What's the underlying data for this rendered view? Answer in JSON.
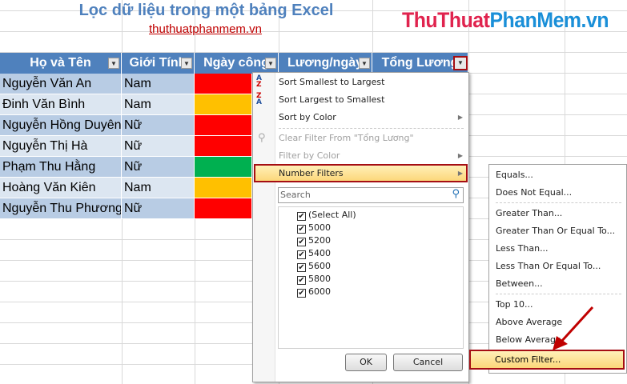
{
  "title": "Lọc dữ liệu trong một bảng Excel",
  "link": "thuthuatphanmem.vn",
  "logo": {
    "part1": "ThuThuat",
    "part2": "PhanMem.vn"
  },
  "headers": [
    "Họ và Tên",
    "Giới Tính",
    "Ngày công",
    "Lương/ngày",
    "Tổng Lương"
  ],
  "rows": [
    {
      "name": "Nguyễn Văn An",
      "gender": "Nam",
      "color": "#ff0000"
    },
    {
      "name": "Đinh Văn Bình",
      "gender": "Nam",
      "color": "#ffc000"
    },
    {
      "name": "Nguyễn Hồng Duyên",
      "gender": "Nữ",
      "color": "#ff0000"
    },
    {
      "name": "Nguyễn Thị Hà",
      "gender": "Nữ",
      "color": "#ff0000"
    },
    {
      "name": "Phạm Thu Hằng",
      "gender": "Nữ",
      "color": "#00b050"
    },
    {
      "name": "Hoàng Văn Kiên",
      "gender": "Nam",
      "color": "#ffc000"
    },
    {
      "name": "Nguyễn Thu Phương",
      "gender": "Nữ",
      "color": "#ff0000"
    }
  ],
  "menu": {
    "sort_asc": "Sort Smallest to Largest",
    "sort_desc": "Sort Largest to Smallest",
    "sort_color": "Sort by Color",
    "clear_filter": "Clear Filter From \"Tổng Lương\"",
    "filter_color": "Filter by Color",
    "number_filters": "Number Filters",
    "search_placeholder": "Search",
    "items": [
      "(Select All)",
      "5000",
      "5200",
      "5400",
      "5600",
      "5800",
      "6000"
    ],
    "ok": "OK",
    "cancel": "Cancel"
  },
  "submenu": [
    "Equals...",
    "Does Not Equal...",
    "Greater Than...",
    "Greater Than Or Equal To...",
    "Less Than...",
    "Less Than Or Equal To...",
    "Between...",
    "Top 10...",
    "Above Average",
    "Below Average",
    "Custom Filter..."
  ]
}
